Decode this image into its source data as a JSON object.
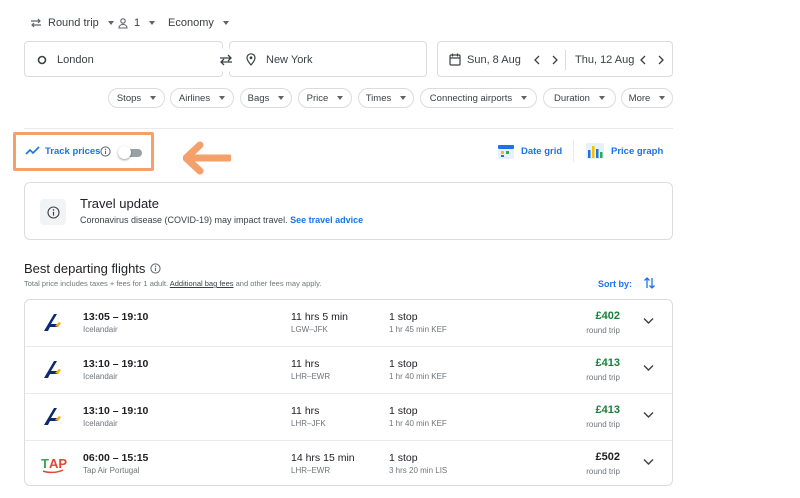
{
  "trip": {
    "trip_type": "Round trip",
    "passengers": "1",
    "cabin_class": "Economy"
  },
  "search": {
    "origin": "London",
    "destination": "New York",
    "depart_date": "Sun, 8 Aug",
    "return_date": "Thu, 12 Aug"
  },
  "filters": [
    "Stops",
    "Airlines",
    "Bags",
    "Price",
    "Times",
    "Connecting airports",
    "Duration",
    "More"
  ],
  "tools": {
    "track_prices_label": "Track prices",
    "track_prices_on": false,
    "date_grid_label": "Date grid",
    "price_graph_label": "Price graph"
  },
  "travel_update": {
    "title": "Travel update",
    "message": "Coronavirus disease (COVID-19) may impact travel. ",
    "link": "See travel advice"
  },
  "results": {
    "heading": "Best departing flights",
    "subtitle_prefix": "Total price includes taxes + fees for 1 adult. ",
    "subtitle_link": "Additional bag fees",
    "subtitle_suffix": " and other fees may apply.",
    "sort_label": "Sort by:",
    "flights": [
      {
        "times": "13:05 – 19:10",
        "airline": "Icelandair",
        "logo": "icelandair",
        "duration": "11 hrs 5 min",
        "route": "LGW–JFK",
        "stops": "1 stop",
        "layover": "1 hr 45 min KEF",
        "price": "£402",
        "price_type": "round trip",
        "price_color": "#188038"
      },
      {
        "times": "13:10 – 19:10",
        "airline": "Icelandair",
        "logo": "icelandair",
        "duration": "11 hrs",
        "route": "LHR–EWR",
        "stops": "1 stop",
        "layover": "1 hr 40 min KEF",
        "price": "£413",
        "price_type": "round trip",
        "price_color": "#188038"
      },
      {
        "times": "13:10 – 19:10",
        "airline": "Icelandair",
        "logo": "icelandair",
        "duration": "11 hrs",
        "route": "LHR–JFK",
        "stops": "1 stop",
        "layover": "1 hr 40 min KEF",
        "price": "£413",
        "price_type": "round trip",
        "price_color": "#188038"
      },
      {
        "times": "06:00 – 15:15",
        "airline": "Tap Air Portugal",
        "logo": "tap",
        "duration": "14 hrs 15 min",
        "route": "LHR–EWR",
        "stops": "1 stop",
        "layover": "3 hrs 20 min LIS",
        "price": "£502",
        "price_type": "round trip",
        "price_color": "#202124"
      }
    ]
  },
  "colors": {
    "accent": "#1a73e8",
    "highlight": "#f3a06a",
    "price_green": "#188038"
  }
}
